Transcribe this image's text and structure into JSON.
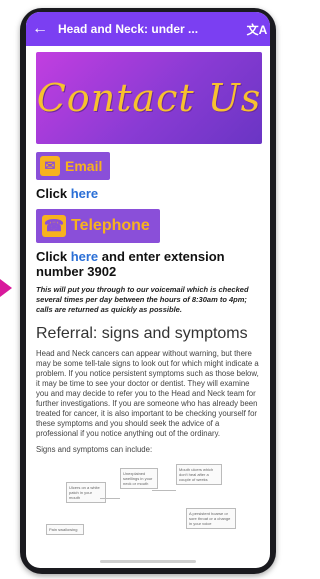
{
  "app_bar": {
    "back_icon": "arrow-left-icon",
    "title": "Head and Neck: under ...",
    "translate_icon": "translate-icon",
    "color": "#7b3ff2"
  },
  "banner": {
    "text": "Contact Us"
  },
  "email_button": {
    "label": "Email",
    "icon": "envelope-person-icon"
  },
  "email_click": {
    "prefix": "Click ",
    "link": "here"
  },
  "telephone_button": {
    "label": "Telephone",
    "icon": "telephone-icon"
  },
  "tel_click": {
    "prefix": "Click ",
    "link": "here",
    "suffix": " and enter extension number 3902"
  },
  "note": "This will put you through to our voicemail which is checked several times per day between the hours of 8:30am to 4pm; calls are returned as quickly as possible.",
  "referral": {
    "heading": "Referral: signs and symptoms",
    "body": "Head and Neck cancers can appear without warning, but there may be some tell-tale signs to look out for which might indicate a problem. If you notice persistent symptoms such as those below, it may be time to see your doctor or dentist. They will examine you and may decide to refer you to the Head and Neck team for further investigations. If you are someone who has already been treated for cancer, it is also important to be checking yourself for these symptoms and you should seek the advice of a professional if you notice anything out of the ordinary.",
    "subheading": "Signs and symptoms can include:"
  },
  "diagram": {
    "boxes": [
      "Ulcers on a white patch in your mouth",
      "Unexplained swellings in your neck or mouth",
      "Mouth ulcers which don't heal after a couple of weeks",
      "A persistent hoarse or sore throat or a change in your voice",
      "Pain swallowing"
    ]
  },
  "accents": {
    "pointer": "#d8199c",
    "button_bg": "#8a4fd9",
    "button_fg": "#f7b21f",
    "banner_text": "#f7c12f"
  }
}
